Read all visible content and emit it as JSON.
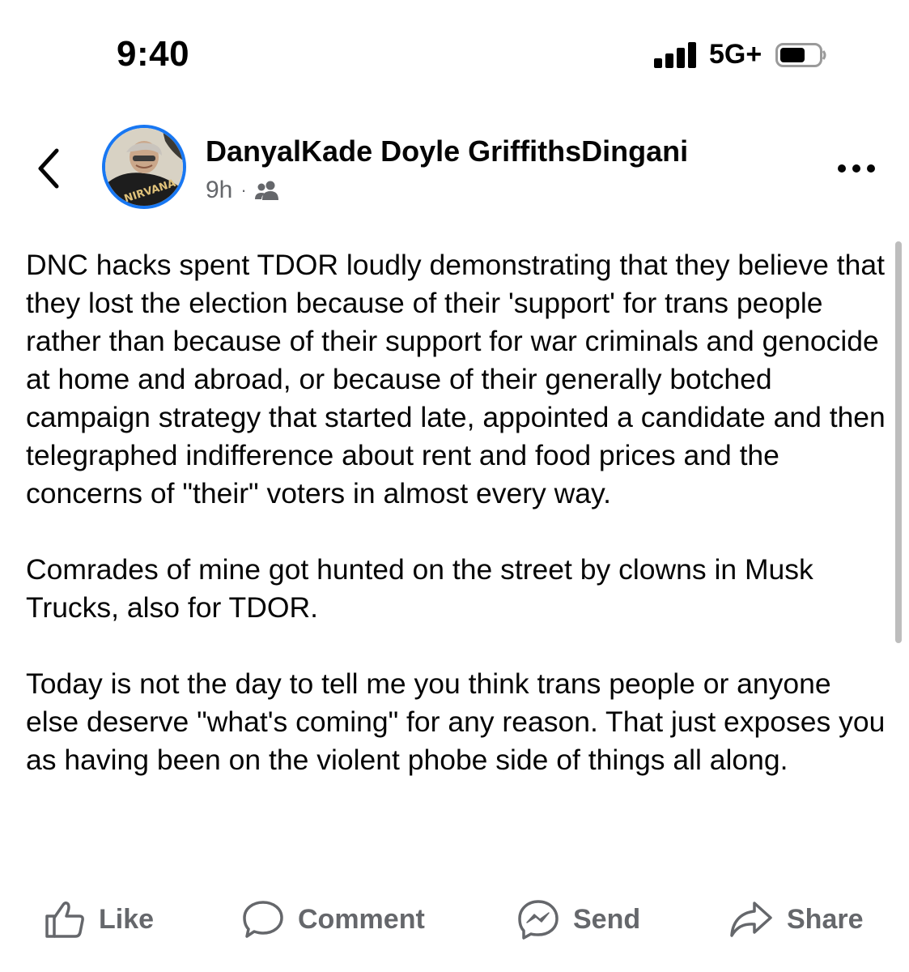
{
  "status_bar": {
    "time": "9:40",
    "network": "5G+"
  },
  "post": {
    "author": "DanyalKade Doyle GriffithsDingani",
    "time_ago": "9h",
    "separator": "·",
    "audience_icon": "friends-icon",
    "paragraphs": [
      "DNC hacks spent TDOR loudly demonstrating that they believe that  they lost the election because of their 'support' for trans people rather than because of their support for war criminals and genocide at home and abroad,  or because of their generally botched campaign strategy that started late, appointed a candidate and then telegraphed indifference about rent and food prices and the concerns of \"their\" voters in almost every way.",
      "Comrades of mine got hunted on the street by clowns in Musk Trucks,  also for TDOR.",
      "Today is not the day to tell me you think trans people or anyone else deserve \"what's coming\" for any reason. That just exposes you as having been on the violent phobe side of things all along."
    ]
  },
  "actions": {
    "like": "Like",
    "comment": "Comment",
    "send": "Send",
    "share": "Share"
  },
  "colors": {
    "accent": "#1877f2",
    "secondary_text": "#65676b",
    "primary_text": "#050505"
  }
}
